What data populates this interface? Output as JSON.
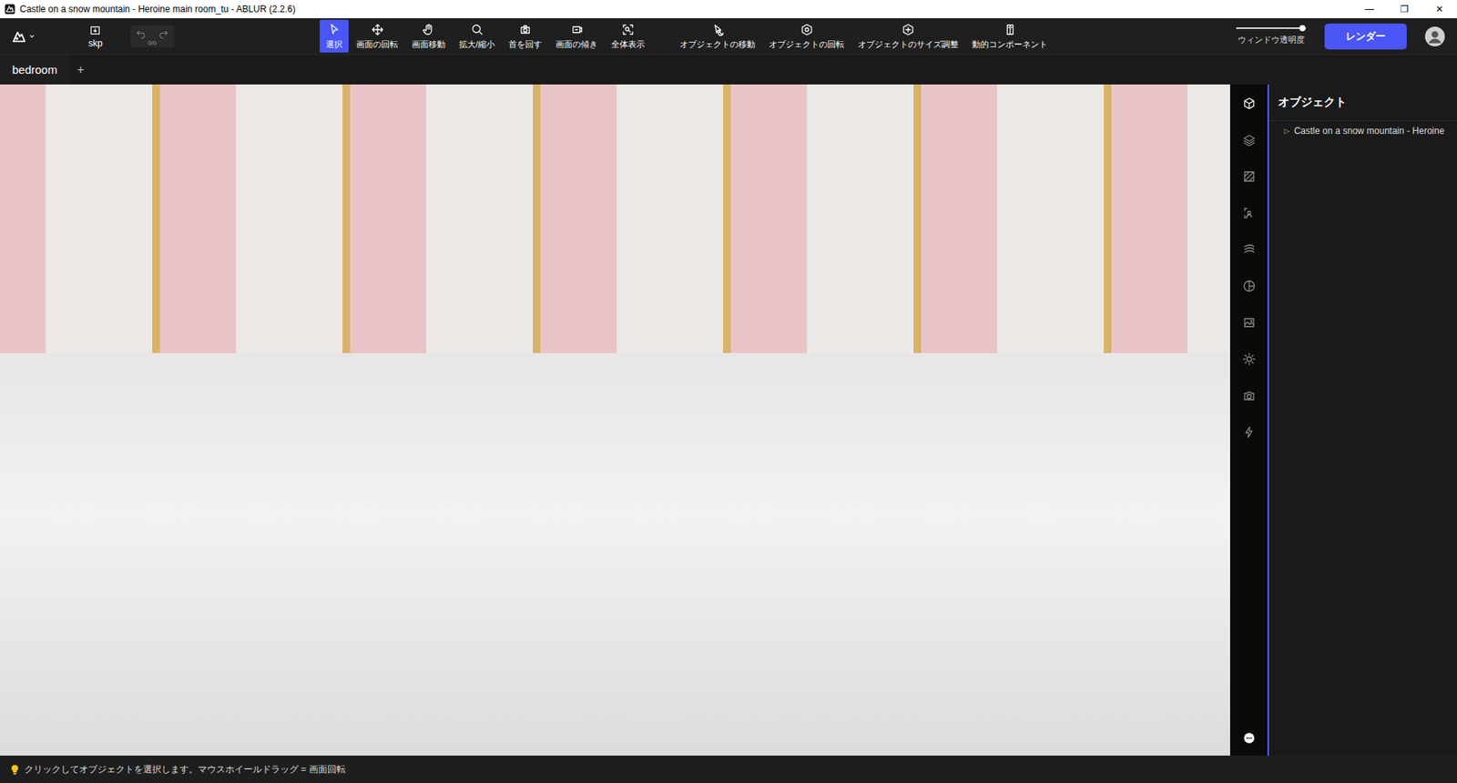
{
  "window": {
    "title": "Castle on a snow mountain - Heroine main room_tu - ABLUR (2.2.6)",
    "controls": [
      "—",
      "❐",
      "✕"
    ]
  },
  "toolbar": {
    "file_button": {
      "label": "skp"
    },
    "history": {
      "counter": "0/0",
      "undo_disabled": true,
      "redo_disabled": true
    },
    "view_tools": [
      {
        "label": "選択",
        "selected": true
      },
      {
        "label": "画面の回転",
        "selected": false
      },
      {
        "label": "画面移動",
        "selected": false
      },
      {
        "label": "拡大/縮小",
        "selected": false
      },
      {
        "label": "首を回す",
        "selected": false
      },
      {
        "label": "画面の傾き",
        "selected": false
      },
      {
        "label": "全体表示",
        "selected": false
      }
    ],
    "object_tools": [
      {
        "label": "オブジェクトの移動",
        "selected": false
      },
      {
        "label": "オブジェクトの回転",
        "selected": false
      },
      {
        "label": "オブジェクトのサイズ調整",
        "selected": false
      },
      {
        "label": "動的コンポーネント",
        "selected": false
      }
    ],
    "opacity_slider": {
      "label": "ウィンドウ透明度",
      "level": 0.95
    },
    "render_button": {
      "label": "レンダー"
    }
  },
  "tabs": [
    {
      "label": "bedroom",
      "selected": true
    }
  ],
  "add_tab": {
    "label": "+"
  },
  "side_icons": [
    {
      "selected": true
    },
    {
      "selected": false
    },
    {
      "selected": false
    },
    {
      "selected": false
    },
    {
      "selected": false
    },
    {
      "selected": false
    },
    {
      "selected": false
    },
    {
      "selected": false
    },
    {
      "selected": false
    },
    {
      "selected": false
    }
  ],
  "panel": {
    "title": "オブジェクト",
    "tree": [
      {
        "label": "Castle on a snow mountain - Heroine",
        "expander": "▷",
        "expanded": false
      }
    ]
  },
  "status_bar": {
    "hint": "クリックしてオブジェクトを選択します。マウスホイールドラッグ = 画面回転"
  }
}
